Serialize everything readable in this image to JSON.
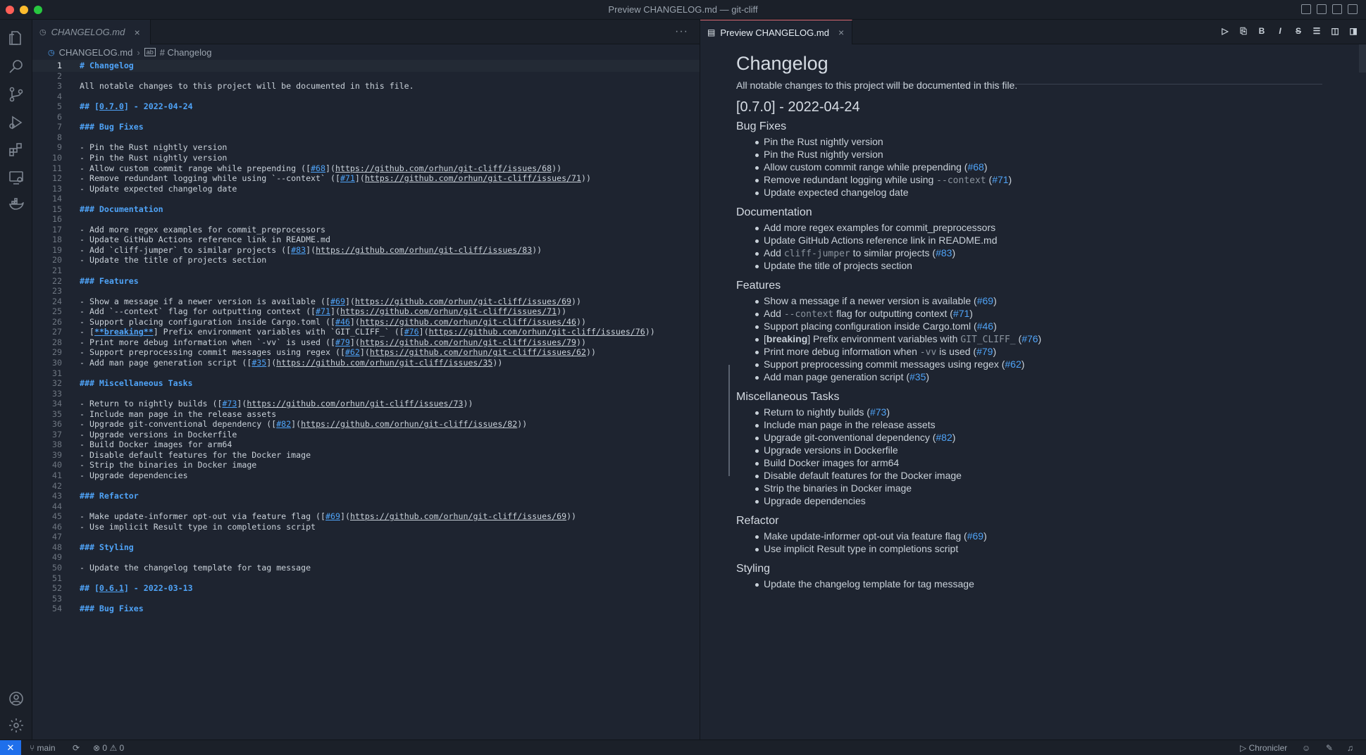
{
  "window": {
    "title": "Preview CHANGELOG.md — git-cliff"
  },
  "activity_bar": [
    "files-icon",
    "search-icon",
    "source-control-icon",
    "run-debug-icon",
    "extensions-icon",
    "remote-explorer-icon",
    "docker-icon",
    "account-icon",
    "settings-icon"
  ],
  "editor": {
    "tab_label": "CHANGELOG.md",
    "breadcrumb": {
      "file": "CHANGELOG.md",
      "symbol": "# Changelog"
    },
    "lines": [
      {
        "n": "1",
        "text": "# Changelog",
        "kind": "h"
      },
      {
        "n": "2",
        "text": ""
      },
      {
        "n": "3",
        "text": "All notable changes to this project will be documented in this file."
      },
      {
        "n": "4",
        "text": ""
      },
      {
        "n": "5",
        "text": "## [0.7.0] - 2022-04-24",
        "kind": "h"
      },
      {
        "n": "6",
        "text": ""
      },
      {
        "n": "7",
        "text": "### Bug Fixes",
        "kind": "h"
      },
      {
        "n": "8",
        "text": ""
      },
      {
        "n": "9",
        "text": "- Pin the Rust nightly version"
      },
      {
        "n": "10",
        "text": "- Pin the Rust nightly version"
      },
      {
        "n": "11",
        "text": "- Allow custom commit range while prepending ([#68](https://github.com/orhun/git-cliff/issues/68))"
      },
      {
        "n": "12",
        "text": "- Remove redundant logging while using `--context` ([#71](https://github.com/orhun/git-cliff/issues/71))"
      },
      {
        "n": "13",
        "text": "- Update expected changelog date"
      },
      {
        "n": "14",
        "text": ""
      },
      {
        "n": "15",
        "text": "### Documentation",
        "kind": "h"
      },
      {
        "n": "16",
        "text": ""
      },
      {
        "n": "17",
        "text": "- Add more regex examples for commit_preprocessors"
      },
      {
        "n": "18",
        "text": "- Update GitHub Actions reference link in README.md"
      },
      {
        "n": "19",
        "text": "- Add `cliff-jumper` to similar projects ([#83](https://github.com/orhun/git-cliff/issues/83))"
      },
      {
        "n": "20",
        "text": "- Update the title of projects section"
      },
      {
        "n": "21",
        "text": ""
      },
      {
        "n": "22",
        "text": "### Features",
        "kind": "h"
      },
      {
        "n": "23",
        "text": ""
      },
      {
        "n": "24",
        "text": "- Show a message if a newer version is available ([#69](https://github.com/orhun/git-cliff/issues/69))"
      },
      {
        "n": "25",
        "text": "- Add `--context` flag for outputting context ([#71](https://github.com/orhun/git-cliff/issues/71))"
      },
      {
        "n": "26",
        "text": "- Support placing configuration inside Cargo.toml ([#46](https://github.com/orhun/git-cliff/issues/46))"
      },
      {
        "n": "27",
        "text": "- [**breaking**] Prefix environment variables with `GIT_CLIFF_` ([#76](https://github.com/orhun/git-cliff/issues/76))"
      },
      {
        "n": "28",
        "text": "- Print more debug information when `-vv` is used ([#79](https://github.com/orhun/git-cliff/issues/79))"
      },
      {
        "n": "29",
        "text": "- Support preprocessing commit messages using regex ([#62](https://github.com/orhun/git-cliff/issues/62))"
      },
      {
        "n": "30",
        "text": "- Add man page generation script ([#35](https://github.com/orhun/git-cliff/issues/35))"
      },
      {
        "n": "31",
        "text": ""
      },
      {
        "n": "32",
        "text": "### Miscellaneous Tasks",
        "kind": "h"
      },
      {
        "n": "33",
        "text": ""
      },
      {
        "n": "34",
        "text": "- Return to nightly builds ([#73](https://github.com/orhun/git-cliff/issues/73))"
      },
      {
        "n": "35",
        "text": "- Include man page in the release assets"
      },
      {
        "n": "36",
        "text": "- Upgrade git-conventional dependency ([#82](https://github.com/orhun/git-cliff/issues/82))"
      },
      {
        "n": "37",
        "text": "- Upgrade versions in Dockerfile"
      },
      {
        "n": "38",
        "text": "- Build Docker images for arm64"
      },
      {
        "n": "39",
        "text": "- Disable default features for the Docker image"
      },
      {
        "n": "40",
        "text": "- Strip the binaries in Docker image"
      },
      {
        "n": "41",
        "text": "- Upgrade dependencies"
      },
      {
        "n": "42",
        "text": ""
      },
      {
        "n": "43",
        "text": "### Refactor",
        "kind": "h"
      },
      {
        "n": "44",
        "text": ""
      },
      {
        "n": "45",
        "text": "- Make update-informer opt-out via feature flag ([#69](https://github.com/orhun/git-cliff/issues/69))"
      },
      {
        "n": "46",
        "text": "- Use implicit Result type in completions script"
      },
      {
        "n": "47",
        "text": ""
      },
      {
        "n": "48",
        "text": "### Styling",
        "kind": "h"
      },
      {
        "n": "49",
        "text": ""
      },
      {
        "n": "50",
        "text": "- Update the changelog template for tag message"
      },
      {
        "n": "51",
        "text": ""
      },
      {
        "n": "52",
        "text": "## [0.6.1] - 2022-03-13",
        "kind": "h"
      },
      {
        "n": "53",
        "text": ""
      },
      {
        "n": "54",
        "text": "### Bug Fixes",
        "kind": "h"
      }
    ]
  },
  "preview": {
    "tab_label": "Preview CHANGELOG.md",
    "toolbar": [
      "▷",
      "⎘",
      "B",
      "I",
      "S",
      "☰",
      "◫",
      "◨"
    ],
    "blocks": [
      {
        "t": "h1",
        "text": "Changelog"
      },
      {
        "t": "p",
        "text": "All notable changes to this project will be documented in this file."
      },
      {
        "t": "h2",
        "text": "[0.7.0] - 2022-04-24"
      },
      {
        "t": "h3",
        "text": "Bug Fixes"
      },
      {
        "t": "li",
        "parts": [
          {
            "s": "Pin the Rust nightly version"
          }
        ]
      },
      {
        "t": "li",
        "parts": [
          {
            "s": "Pin the Rust nightly version"
          }
        ]
      },
      {
        "t": "li",
        "parts": [
          {
            "s": "Allow custom commit range while prepending ("
          },
          {
            "s": "#68",
            "k": "link"
          },
          {
            "s": ")"
          }
        ]
      },
      {
        "t": "li",
        "parts": [
          {
            "s": "Remove redundant logging while using "
          },
          {
            "s": "--context",
            "k": "code"
          },
          {
            "s": " ("
          },
          {
            "s": "#71",
            "k": "link"
          },
          {
            "s": ")"
          }
        ]
      },
      {
        "t": "li",
        "parts": [
          {
            "s": "Update expected changelog date"
          }
        ]
      },
      {
        "t": "h3",
        "text": "Documentation"
      },
      {
        "t": "li",
        "parts": [
          {
            "s": "Add more regex examples for commit_preprocessors"
          }
        ]
      },
      {
        "t": "li",
        "parts": [
          {
            "s": "Update GitHub Actions reference link in README.md"
          }
        ]
      },
      {
        "t": "li",
        "parts": [
          {
            "s": "Add "
          },
          {
            "s": "cliff-jumper",
            "k": "code"
          },
          {
            "s": " to similar projects ("
          },
          {
            "s": "#83",
            "k": "link"
          },
          {
            "s": ")"
          }
        ]
      },
      {
        "t": "li",
        "parts": [
          {
            "s": "Update the title of projects section"
          }
        ]
      },
      {
        "t": "h3",
        "text": "Features"
      },
      {
        "t": "li",
        "parts": [
          {
            "s": "Show a message if a newer version is available ("
          },
          {
            "s": "#69",
            "k": "link"
          },
          {
            "s": ")"
          }
        ]
      },
      {
        "t": "li",
        "parts": [
          {
            "s": "Add "
          },
          {
            "s": "--context",
            "k": "code"
          },
          {
            "s": " flag for outputting context ("
          },
          {
            "s": "#71",
            "k": "link"
          },
          {
            "s": ")"
          }
        ]
      },
      {
        "t": "li",
        "parts": [
          {
            "s": "Support placing configuration inside Cargo.toml ("
          },
          {
            "s": "#46",
            "k": "link"
          },
          {
            "s": ")"
          }
        ]
      },
      {
        "t": "li",
        "parts": [
          {
            "s": "["
          },
          {
            "s": "breaking",
            "k": "bold"
          },
          {
            "s": "] Prefix environment variables with "
          },
          {
            "s": "GIT_CLIFF_",
            "k": "code"
          },
          {
            "s": " ("
          },
          {
            "s": "#76",
            "k": "link"
          },
          {
            "s": ")"
          }
        ]
      },
      {
        "t": "li",
        "parts": [
          {
            "s": "Print more debug information when "
          },
          {
            "s": "-vv",
            "k": "code"
          },
          {
            "s": " is used ("
          },
          {
            "s": "#79",
            "k": "link"
          },
          {
            "s": ")"
          }
        ]
      },
      {
        "t": "li",
        "parts": [
          {
            "s": "Support preprocessing commit messages using regex ("
          },
          {
            "s": "#62",
            "k": "link"
          },
          {
            "s": ")"
          }
        ]
      },
      {
        "t": "li",
        "parts": [
          {
            "s": "Add man page generation script ("
          },
          {
            "s": "#35",
            "k": "link"
          },
          {
            "s": ")"
          }
        ]
      },
      {
        "t": "h3",
        "text": "Miscellaneous Tasks"
      },
      {
        "t": "li",
        "parts": [
          {
            "s": "Return to nightly builds ("
          },
          {
            "s": "#73",
            "k": "link"
          },
          {
            "s": ")"
          }
        ]
      },
      {
        "t": "li",
        "parts": [
          {
            "s": "Include man page in the release assets"
          }
        ]
      },
      {
        "t": "li",
        "parts": [
          {
            "s": "Upgrade git-conventional dependency ("
          },
          {
            "s": "#82",
            "k": "link"
          },
          {
            "s": ")"
          }
        ]
      },
      {
        "t": "li",
        "parts": [
          {
            "s": "Upgrade versions in Dockerfile"
          }
        ]
      },
      {
        "t": "li",
        "parts": [
          {
            "s": "Build Docker images for arm64"
          }
        ]
      },
      {
        "t": "li",
        "parts": [
          {
            "s": "Disable default features for the Docker image"
          }
        ]
      },
      {
        "t": "li",
        "parts": [
          {
            "s": "Strip the binaries in Docker image"
          }
        ]
      },
      {
        "t": "li",
        "parts": [
          {
            "s": "Upgrade dependencies"
          }
        ]
      },
      {
        "t": "h3",
        "text": "Refactor"
      },
      {
        "t": "li",
        "parts": [
          {
            "s": "Make update-informer opt-out via feature flag ("
          },
          {
            "s": "#69",
            "k": "link"
          },
          {
            "s": ")"
          }
        ]
      },
      {
        "t": "li",
        "parts": [
          {
            "s": "Use implicit Result type in completions script"
          }
        ]
      },
      {
        "t": "h3",
        "text": "Styling"
      },
      {
        "t": "li",
        "parts": [
          {
            "s": "Update the changelog template for tag message"
          }
        ]
      }
    ]
  },
  "status_bar": {
    "branch": "main",
    "problems": "0",
    "warnings": "0",
    "right_item": "Chronicler"
  },
  "colors": {
    "accent": "#1f6feb",
    "link": "#4fa3f7",
    "active_tab_border": "#e06c75"
  }
}
